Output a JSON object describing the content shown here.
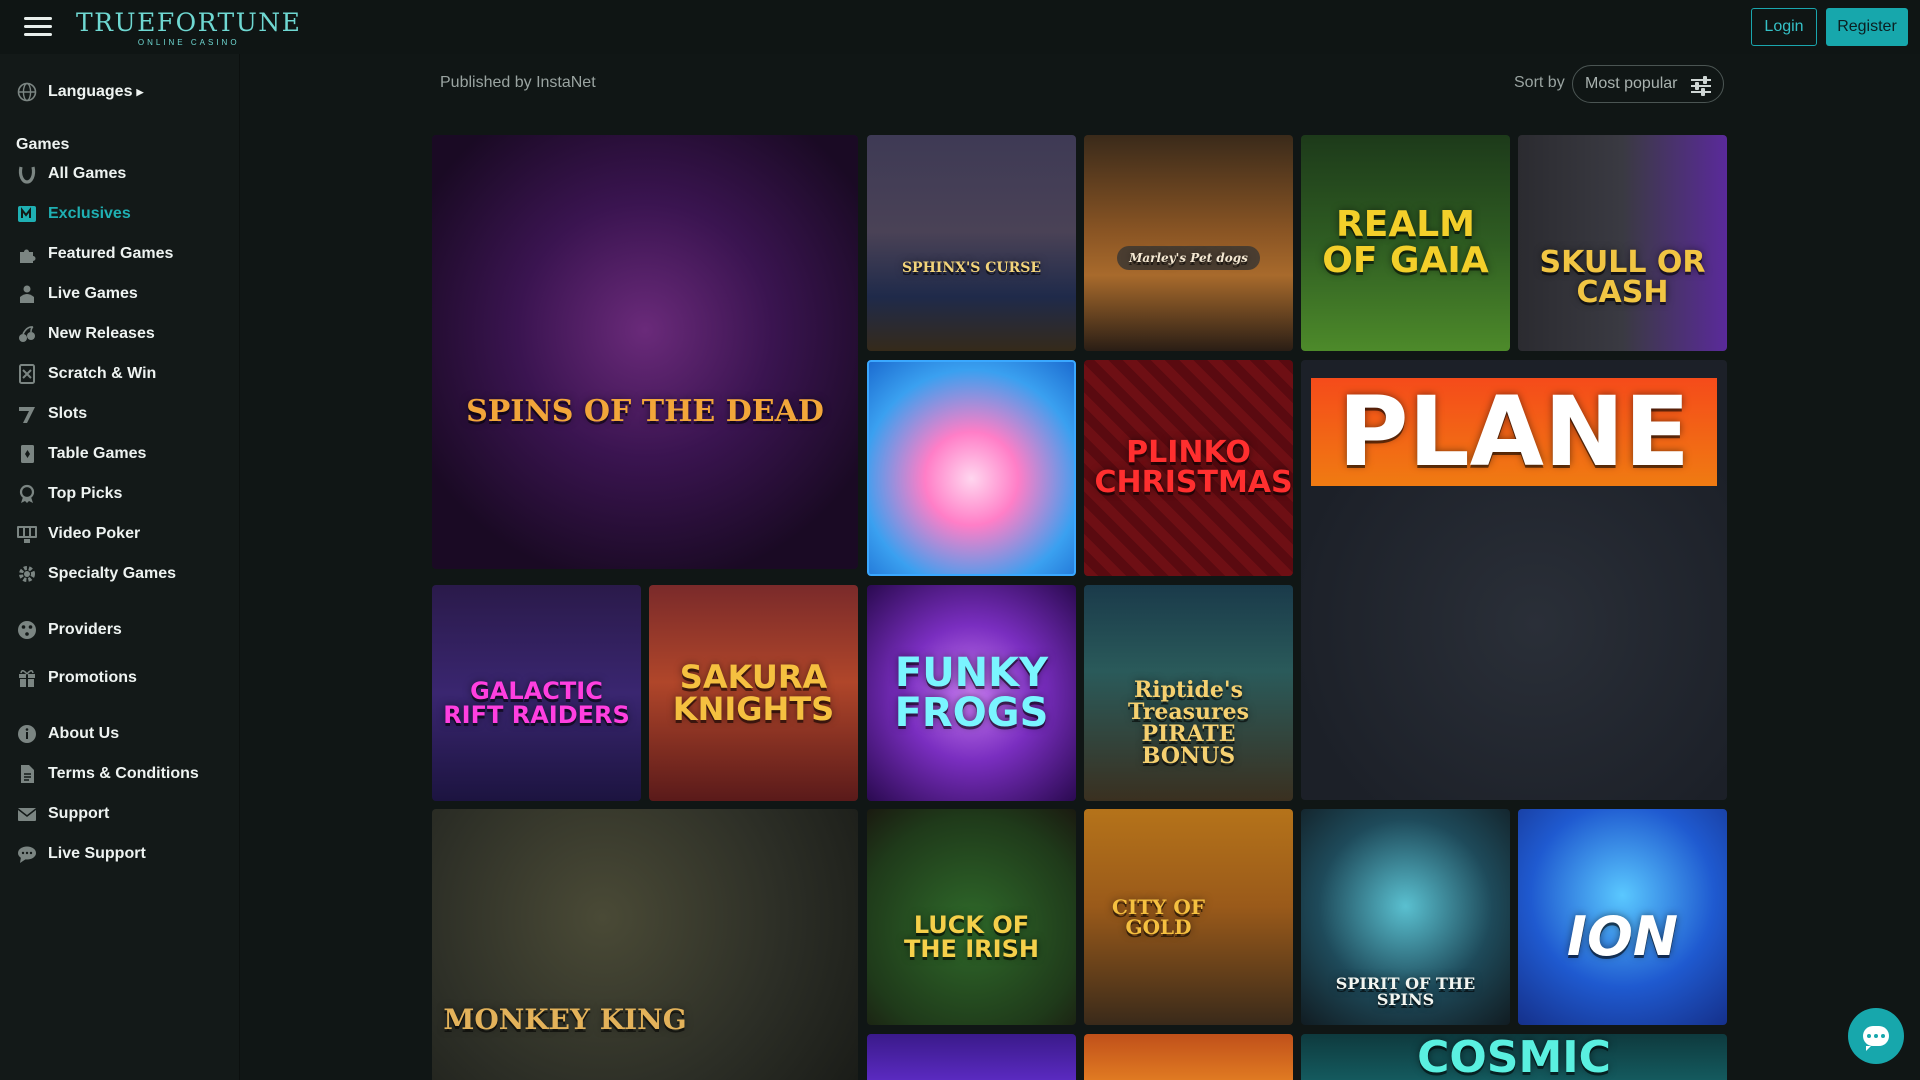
{
  "header": {
    "logo_main": "TRUEFORTUNE",
    "logo_sub": "ONLINE CASINO",
    "login_label": "Login",
    "register_label": "Register"
  },
  "sidebar": {
    "languages_label": "Languages",
    "games_heading": "Games",
    "items": [
      {
        "label": "All Games",
        "icon": "horseshoe-icon"
      },
      {
        "label": "Exclusives",
        "icon": "exclusive-icon",
        "active": true
      },
      {
        "label": "Featured Games",
        "icon": "puzzle-icon"
      },
      {
        "label": "Live Games",
        "icon": "dealer-icon"
      },
      {
        "label": "New Releases",
        "icon": "cherries-icon"
      },
      {
        "label": "Scratch & Win",
        "icon": "scratch-card-icon"
      },
      {
        "label": "Slots",
        "icon": "seven-icon"
      },
      {
        "label": "Table Games",
        "icon": "cards-icon"
      },
      {
        "label": "Top Picks",
        "icon": "rosette-icon"
      },
      {
        "label": "Video Poker",
        "icon": "video-poker-icon"
      },
      {
        "label": "Specialty Games",
        "icon": "gear-icon"
      }
    ],
    "providers_label": "Providers",
    "promotions_label": "Promotions",
    "footer_items": [
      {
        "label": "About Us",
        "icon": "info-icon"
      },
      {
        "label": "Terms & Conditions",
        "icon": "document-icon"
      },
      {
        "label": "Support",
        "icon": "mail-icon"
      },
      {
        "label": "Live Support",
        "icon": "chat-icon"
      }
    ]
  },
  "main": {
    "published_by": "Published by InstaNet",
    "sort_label": "Sort by",
    "sort_value": "Most popular"
  },
  "games": [
    {
      "title": "SPINS OF THE DEAD"
    },
    {
      "title": "SPHINX'S CURSE"
    },
    {
      "title": "Marley's Pet dogs"
    },
    {
      "title": "REALM OF GAIA"
    },
    {
      "title": "SKULL OR CASH"
    },
    {
      "title": ""
    },
    {
      "title": "PLINKO CHRISTMAS"
    },
    {
      "title": "PLANE"
    },
    {
      "title": "GALACTIC RIFT RAIDERS"
    },
    {
      "title": "SAKURA KNIGHTS"
    },
    {
      "title": "FUNKY FROGS"
    },
    {
      "title": "Riptide's Treasures PIRATE BONUS"
    },
    {
      "title": "MONKEY KING"
    },
    {
      "title": "LUCK OF THE IRISH"
    },
    {
      "title": "CITY OF GOLD"
    },
    {
      "title": "SPIRIT OF THE SPINS"
    },
    {
      "title": "ION"
    },
    {
      "title": ""
    },
    {
      "title": ""
    },
    {
      "title": "COSMIC"
    }
  ]
}
